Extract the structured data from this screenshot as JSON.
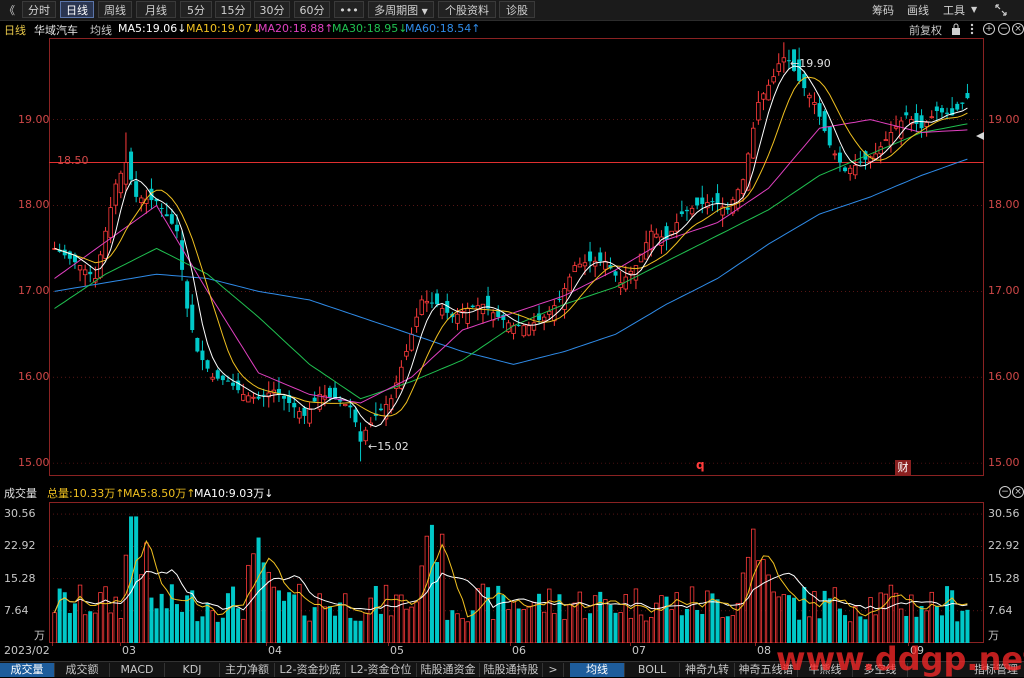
{
  "toolbar": {
    "back": "《",
    "buttons": [
      "分时",
      "日线",
      "周线",
      "月线",
      "5分",
      "15分",
      "30分",
      "60分",
      "•••",
      "多周期图",
      "个股资料",
      "诊股"
    ],
    "right": [
      "筹码",
      "画线",
      "工具"
    ],
    "dropdown_caret": "▼"
  },
  "ma_row": {
    "period": "日线",
    "stock": "华域汽车",
    "avg_label": "均线",
    "ma5": "MA5:19.06↓",
    "ma10": "MA10:19.07↓",
    "ma20": "MA20:18.88↑",
    "ma30": "MA30:18.95↓",
    "ma60": "MA60:18.54↑",
    "adjust": "前复权"
  },
  "colors": {
    "up": "#ff3b3b",
    "down": "#00c8c8",
    "ma5": "#ffffff",
    "ma10": "#f0c020",
    "ma20": "#e040c0",
    "ma30": "#20c050",
    "ma60": "#2f8be8",
    "grid": "#8a2222"
  },
  "price_axis": {
    "ticks": [
      "19.00",
      "18.00",
      "17.00",
      "16.00",
      "15.00"
    ],
    "hline_label": "18.50",
    "max_label": "19.90",
    "min_label": "15.02",
    "markers": [
      "q",
      "财"
    ]
  },
  "vol_row": {
    "title": "成交量",
    "total": "总量:10.33万↑",
    "ma5": "MA5:8.50万↑",
    "ma10": "MA10:9.03万↓"
  },
  "vol_axis": {
    "ticks": [
      "30.56",
      "22.92",
      "15.28",
      "7.64"
    ],
    "unit": "万"
  },
  "x_axis": [
    "2023/02",
    "03",
    "04",
    "05",
    "06",
    "07",
    "08",
    "09"
  ],
  "tabs_left": [
    "成交量",
    "成交额",
    "MACD",
    "KDJ",
    "主力净额",
    "L2-资金抄底",
    "L2-资金仓位",
    "陆股通资金",
    "陆股通持股"
  ],
  "tabs_right": [
    "均线",
    "BOLL",
    "神奇九转",
    "神奇五线谱",
    "牛熊线",
    "多空线",
    "指标管理"
  ],
  "watermark": "www.ddgp.net",
  "chart_data": {
    "type": "candlestick",
    "price_range": [
      14.85,
      19.95
    ],
    "reference_line": 18.5,
    "volume_range": [
      0,
      32
    ],
    "volume_unit": "万",
    "x_months": [
      "2023/02",
      "03",
      "04",
      "05",
      "06",
      "07",
      "08",
      "09"
    ],
    "close_anchors": [
      [
        0,
        17.5
      ],
      [
        5,
        17.3
      ],
      [
        8,
        17.15
      ],
      [
        10,
        17.7
      ],
      [
        12,
        18.25
      ],
      [
        14,
        18.5
      ],
      [
        16,
        18.1
      ],
      [
        20,
        18.05
      ],
      [
        24,
        17.7
      ],
      [
        26,
        16.8
      ],
      [
        28,
        16.3
      ],
      [
        31,
        16.0
      ],
      [
        34,
        15.95
      ],
      [
        37,
        15.8
      ],
      [
        40,
        15.75
      ],
      [
        43,
        15.85
      ],
      [
        46,
        15.7
      ],
      [
        49,
        15.55
      ],
      [
        52,
        15.8
      ],
      [
        55,
        15.75
      ],
      [
        58,
        15.65
      ],
      [
        60,
        15.3
      ],
      [
        63,
        15.55
      ],
      [
        66,
        15.75
      ],
      [
        69,
        16.3
      ],
      [
        72,
        16.9
      ],
      [
        75,
        16.85
      ],
      [
        78,
        16.7
      ],
      [
        81,
        16.8
      ],
      [
        84,
        16.85
      ],
      [
        87,
        16.7
      ],
      [
        90,
        16.6
      ],
      [
        93,
        16.6
      ],
      [
        96,
        16.7
      ],
      [
        99,
        16.9
      ],
      [
        102,
        17.3
      ],
      [
        105,
        17.35
      ],
      [
        108,
        17.35
      ],
      [
        111,
        17.1
      ],
      [
        114,
        17.3
      ],
      [
        117,
        17.7
      ],
      [
        120,
        17.6
      ],
      [
        123,
        17.9
      ],
      [
        126,
        18.0
      ],
      [
        129,
        18.05
      ],
      [
        132,
        17.95
      ],
      [
        135,
        18.3
      ],
      [
        138,
        19.2
      ],
      [
        141,
        19.5
      ],
      [
        143,
        19.8
      ],
      [
        146,
        19.45
      ],
      [
        149,
        19.2
      ],
      [
        152,
        18.7
      ],
      [
        155,
        18.4
      ],
      [
        158,
        18.5
      ],
      [
        161,
        18.6
      ],
      [
        164,
        18.85
      ],
      [
        167,
        19.05
      ],
      [
        170,
        18.9
      ],
      [
        173,
        19.1
      ],
      [
        176,
        19.05
      ],
      [
        179,
        19.25
      ]
    ],
    "ma_anchors": {
      "ma20": [
        [
          0,
          17.15
        ],
        [
          20,
          18.0
        ],
        [
          30,
          17.0
        ],
        [
          40,
          16.05
        ],
        [
          50,
          15.8
        ],
        [
          60,
          15.7
        ],
        [
          70,
          16.0
        ],
        [
          80,
          16.55
        ],
        [
          90,
          16.75
        ],
        [
          100,
          16.95
        ],
        [
          110,
          17.25
        ],
        [
          120,
          17.6
        ],
        [
          130,
          17.8
        ],
        [
          140,
          18.2
        ],
        [
          150,
          18.9
        ],
        [
          160,
          19.0
        ],
        [
          170,
          18.85
        ],
        [
          179,
          18.88
        ]
      ],
      "ma30": [
        [
          0,
          16.8
        ],
        [
          10,
          17.2
        ],
        [
          20,
          17.5
        ],
        [
          30,
          17.2
        ],
        [
          40,
          16.7
        ],
        [
          50,
          16.15
        ],
        [
          60,
          15.75
        ],
        [
          70,
          15.95
        ],
        [
          80,
          16.2
        ],
        [
          90,
          16.6
        ],
        [
          100,
          16.85
        ],
        [
          110,
          17.05
        ],
        [
          120,
          17.35
        ],
        [
          130,
          17.65
        ],
        [
          140,
          17.95
        ],
        [
          150,
          18.35
        ],
        [
          160,
          18.6
        ],
        [
          170,
          18.85
        ],
        [
          179,
          18.95
        ]
      ],
      "ma60": [
        [
          0,
          17.0
        ],
        [
          10,
          17.1
        ],
        [
          20,
          17.2
        ],
        [
          30,
          17.15
        ],
        [
          40,
          17.0
        ],
        [
          50,
          16.9
        ],
        [
          60,
          16.7
        ],
        [
          70,
          16.5
        ],
        [
          80,
          16.3
        ],
        [
          90,
          16.15
        ],
        [
          100,
          16.3
        ],
        [
          110,
          16.5
        ],
        [
          120,
          16.85
        ],
        [
          130,
          17.15
        ],
        [
          140,
          17.55
        ],
        [
          150,
          17.9
        ],
        [
          160,
          18.1
        ],
        [
          170,
          18.35
        ],
        [
          179,
          18.54
        ]
      ]
    }
  }
}
